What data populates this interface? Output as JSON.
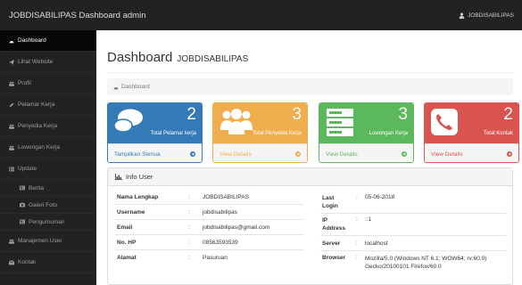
{
  "app": {
    "title": "JOBDISABILIPAS Dashboard admin",
    "user": "JOBDISABILIPAS"
  },
  "sidebar": {
    "items": [
      {
        "label": "Dashboard",
        "icon": "dashboard-icon"
      },
      {
        "label": "Lihat Website",
        "icon": "send-icon"
      },
      {
        "label": "Profil",
        "icon": "users-icon"
      },
      {
        "label": "Pelamar Kerja",
        "icon": "pencil-icon"
      },
      {
        "label": "Penyedia Kerja",
        "icon": "users-icon"
      },
      {
        "label": "Lowongan Kerja",
        "icon": "users-icon"
      },
      {
        "label": "Update",
        "icon": "list-icon"
      },
      {
        "label": "Berita",
        "icon": "newspaper-icon"
      },
      {
        "label": "Galeri Foto",
        "icon": "camera-icon"
      },
      {
        "label": "Pengumuman",
        "icon": "newspaper-icon"
      },
      {
        "label": "Manajemen User",
        "icon": "users-icon"
      },
      {
        "label": "Kontak",
        "icon": "envelope-icon"
      }
    ]
  },
  "page": {
    "title": "Dashboard",
    "subtitle": "JOBDISABILIPAS"
  },
  "breadcrumb": {
    "label": "Dashboard"
  },
  "panels": [
    {
      "count": "2",
      "label": "Total Pelamar kerja",
      "link": "Tampilkan Semua",
      "icon": "comments-icon",
      "color": "#337ab7"
    },
    {
      "count": "3",
      "label": "Total Penyedia Kerja",
      "link": "View Details",
      "icon": "group-icon",
      "color": "#f0ad4e"
    },
    {
      "count": "3",
      "label": "Lowongan Kerja",
      "link": "View Details",
      "icon": "server-icon",
      "color": "#5cb85c"
    },
    {
      "count": "2",
      "label": "Total Kontak",
      "link": "View Details",
      "icon": "phone-icon",
      "color": "#d9534f"
    }
  ],
  "info": {
    "title": "Info User",
    "left": [
      {
        "key": "Nama Lengkap",
        "sep": ":",
        "value": "JOBDISABILIPAS"
      },
      {
        "key": "Username",
        "sep": ":",
        "value": "jobdisabilipas"
      },
      {
        "key": "Email",
        "sep": ":",
        "value": "jobdisabilipas@gmail.com"
      },
      {
        "key": "No. HP",
        "sep": ":",
        "value": "08563593539"
      },
      {
        "key": "Alamat",
        "sep": ":",
        "value": "Pasuruan"
      }
    ],
    "right": [
      {
        "key": "Last Login",
        "sep": ":",
        "value": "05-06-2018"
      },
      {
        "key": "IP Address",
        "sep": ":",
        "value": "::1"
      },
      {
        "key": "Server",
        "sep": ":",
        "value": "localhost"
      },
      {
        "key": "Browser",
        "sep": ":",
        "value": "Mozilla/5.0 (Windows NT 6.1; WOW64; rv:60.0) Gecko/20100101 Firefox/60.0"
      }
    ]
  }
}
